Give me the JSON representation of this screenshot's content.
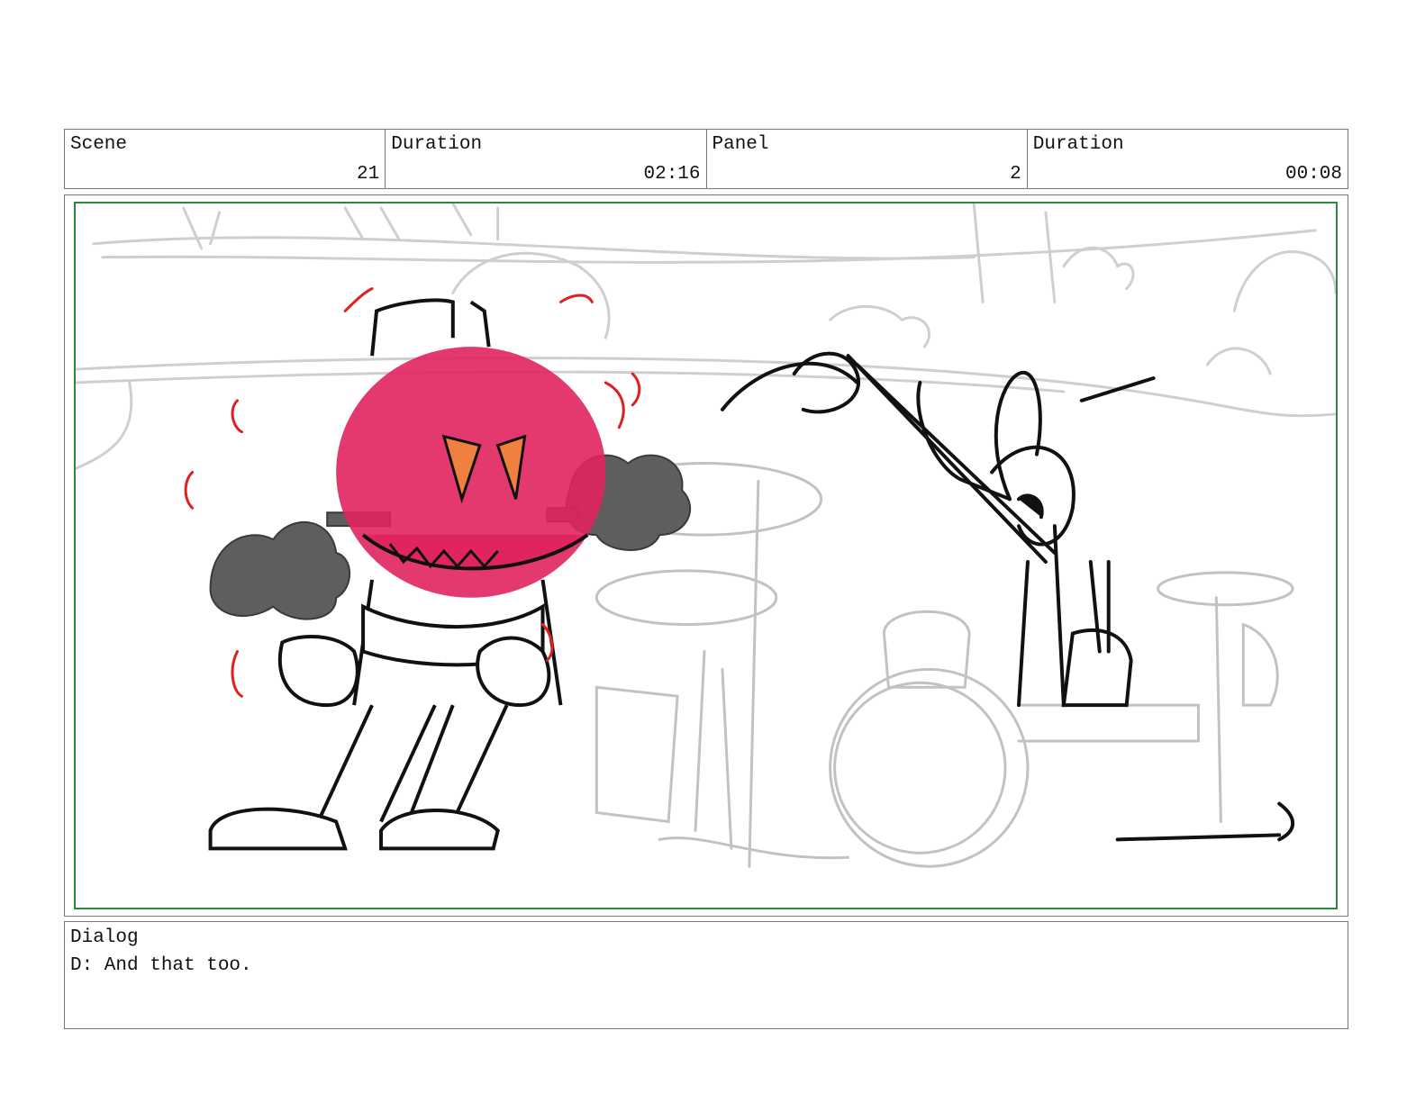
{
  "header": {
    "scene": {
      "label": "Scene",
      "value": "21"
    },
    "scene_duration": {
      "label": "Duration",
      "value": "02:16"
    },
    "panel": {
      "label": "Panel",
      "value": "2"
    },
    "panel_duration": {
      "label": "Duration",
      "value": "00:08"
    }
  },
  "dialog": {
    "label": "Dialog",
    "text": "D: And that too."
  },
  "colors": {
    "frame_border": "#777777",
    "safe_area": "#2a8a3a",
    "angry_face": "#e0245e",
    "steam": "#5e5e5e",
    "sketch_gray": "#c8c8c8",
    "accent_marks": "#e02020"
  }
}
